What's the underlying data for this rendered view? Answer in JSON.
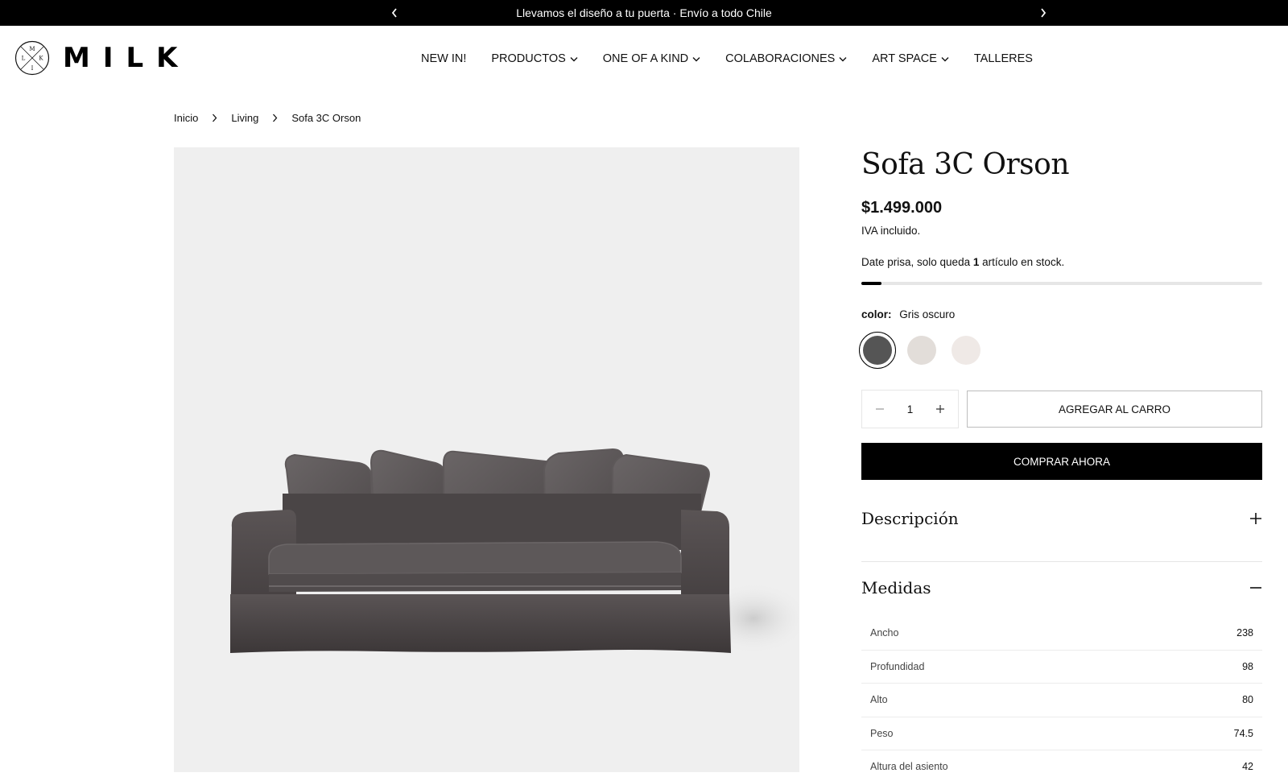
{
  "announcement": {
    "text": "Llevamos el diseño a tu puerta · Envío a todo Chile"
  },
  "logo": {
    "word": "MILK",
    "emblem_letters": [
      "M",
      "K",
      "I",
      "L"
    ]
  },
  "nav": {
    "items": [
      {
        "label": "NEW IN!",
        "dropdown": false
      },
      {
        "label": "PRODUCTOS",
        "dropdown": true
      },
      {
        "label": "ONE OF A KIND",
        "dropdown": true
      },
      {
        "label": "COLABORACIONES",
        "dropdown": true
      },
      {
        "label": "ART SPACE",
        "dropdown": true
      },
      {
        "label": "TALLERES",
        "dropdown": false
      }
    ]
  },
  "breadcrumb": [
    "Inicio",
    "Living",
    "Sofa 3C Orson"
  ],
  "product": {
    "title": "Sofa 3C Orson",
    "price": "$1.499.000",
    "tax_note": "IVA incluido.",
    "stock_prefix": "Date prisa, solo queda",
    "stock_count": "1",
    "stock_suffix": "artículo en stock.",
    "stock_level_fraction": 0.05,
    "color_label": "color:",
    "color_value": "Gris oscuro",
    "swatches": [
      {
        "name": "Gris oscuro",
        "hex": "#555555",
        "selected": true
      },
      {
        "name": "Beige",
        "hex": "#e2ddd9",
        "selected": false
      },
      {
        "name": "Crudo",
        "hex": "#efe9e6",
        "selected": false
      }
    ],
    "quantity": "1",
    "add_to_cart": "AGREGAR AL CARRO",
    "buy_now": "COMPRAR AHORA",
    "description_title": "Descripción",
    "measures_title": "Medidas",
    "specs": [
      {
        "label": "Ancho",
        "value": "238"
      },
      {
        "label": "Profundidad",
        "value": "98"
      },
      {
        "label": "Alto",
        "value": "80"
      },
      {
        "label": "Peso",
        "value": "74.5"
      },
      {
        "label": "Altura del asiento",
        "value": "42"
      }
    ]
  },
  "colors": {
    "bar": "#000000",
    "sofa": "#4a4546",
    "image_bg": "#efefef"
  }
}
